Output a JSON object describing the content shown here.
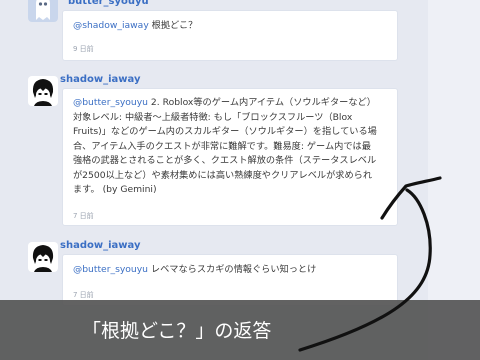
{
  "messages": [
    {
      "username": "butter_syouyu",
      "mention": "@shadow_iaway",
      "text": " 根拠どこ？",
      "time": "9 日前"
    },
    {
      "username": "shadow_iaway",
      "mention": "@butter_syouyu",
      "lines": [
        " 2. Roblox等のゲーム内アイテム（ソウルギターなど）",
        "対象レベル: 中級者〜上級者特徴: もし「ブロックスフルーツ（Blox",
        "Fruits)」などのゲーム内のスカルギター（ソウルギター）を指している場",
        "合、アイテム入手のクエストが非常に難解です。難易度: ゲーム内では最",
        "強格の武器とされることが多く、クエスト解放の条件（ステータスレベル",
        "が2500以上など）や素材集めには高い熟練度やクリアレベルが求められ",
        "ます。 (by Gemini)"
      ],
      "time": "7 日前"
    },
    {
      "username": "shadow_iaway",
      "mention": "@butter_syouyu",
      "text": " レベマならスカギの情報ぐらい知っとけ",
      "time": "7 日前"
    }
  ],
  "caption": "「根拠どこ？」の返答",
  "colors": {
    "background": "#e6e9f1",
    "bubble": "#ffffff",
    "username": "#3b6fc4",
    "caption_bar": "#555555",
    "annotation_arrow": "#111111"
  },
  "icons": [
    "avatar-ghost-icon",
    "avatar-character-icon",
    "hand-drawn-arrow-icon"
  ]
}
